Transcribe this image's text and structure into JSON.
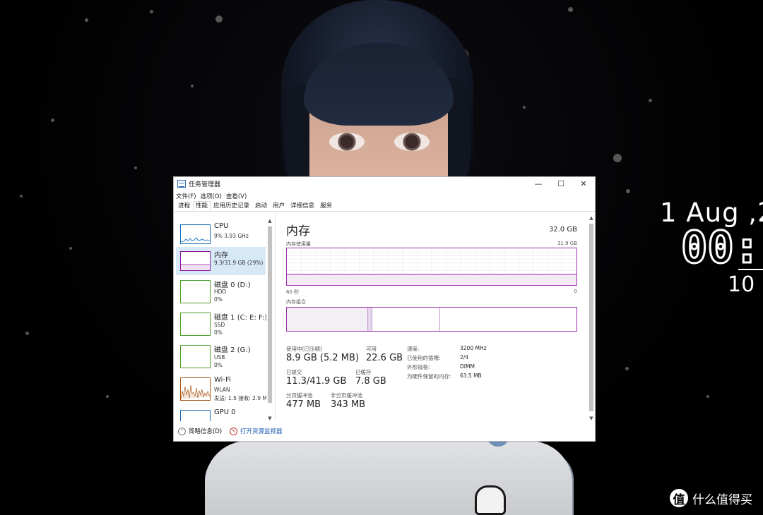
{
  "desktop": {
    "clock": {
      "date": "1 Aug ,2",
      "time": "00:",
      "seconds": "10"
    },
    "watermark": {
      "icon": "值",
      "text": "什么值得买"
    }
  },
  "window": {
    "title": "任务管理器",
    "controls": {
      "minimize": "—",
      "maximize": "☐",
      "close": "✕"
    },
    "menu": [
      "文件(F)",
      "选项(O)",
      "查看(V)"
    ],
    "tabs": [
      "进程",
      "性能",
      "应用历史记录",
      "启动",
      "用户",
      "详细信息",
      "服务"
    ],
    "active_tab": "性能"
  },
  "sidebar": {
    "items": [
      {
        "name": "CPU",
        "sub1": "9% 3.93 GHz",
        "sub2": "",
        "color": "#1b6fb8"
      },
      {
        "name": "内存",
        "sub1": "9.3/31.9 GB (29%)",
        "sub2": "",
        "color": "#8b1c9f",
        "selected": true
      },
      {
        "name": "磁盘 0 (D:)",
        "sub1": "HDD",
        "sub2": "0%",
        "color": "#4b9e2b"
      },
      {
        "name": "磁盘 1 (C: E: F:)",
        "sub1": "SSD",
        "sub2": "0%",
        "color": "#4b9e2b"
      },
      {
        "name": "磁盘 2 (G:)",
        "sub1": "USB",
        "sub2": "0%",
        "color": "#4b9e2b"
      },
      {
        "name": "Wi-Fi",
        "sub1": "WLAN",
        "sub2": "发送: 1.5 接收: 2.9 M",
        "color": "#a9581c"
      },
      {
        "name": "GPU 0",
        "sub1": "",
        "sub2": "",
        "color": "#1b6fb8"
      }
    ]
  },
  "memory": {
    "title": "内存",
    "total": "32.0 GB",
    "usage_label": "内存使用量",
    "usage_max": "31.9 GB",
    "time_left": "60 秒",
    "time_right": "0",
    "composition_label": "内存组合",
    "usage_fraction": 0.29,
    "stats": {
      "in_use_label": "使用中(已压缩)",
      "in_use": "8.9 GB (5.2 MB)",
      "available_label": "可用",
      "available": "22.6 GB",
      "committed_label": "已提交",
      "committed": "11.3/41.9 GB",
      "cached_label": "已缓存",
      "cached": "7.8 GB",
      "paged_label": "分页缓冲池",
      "paged": "477 MB",
      "nonpaged_label": "非分页缓冲池",
      "nonpaged": "343 MB"
    },
    "details": [
      {
        "k": "速度:",
        "v": "3200 MHz"
      },
      {
        "k": "已使用的插槽:",
        "v": "2/4"
      },
      {
        "k": "外形规格:",
        "v": "DIMM"
      },
      {
        "k": "为硬件保留的内存:",
        "v": "63.5 MB"
      }
    ]
  },
  "footer": {
    "brief": "简略信息(D)",
    "monitor": "打开资源监视器"
  },
  "colors": {
    "memory_accent": "#9b2fae",
    "selected_bg": "#d7e8f7",
    "link": "#1a5fb4"
  }
}
